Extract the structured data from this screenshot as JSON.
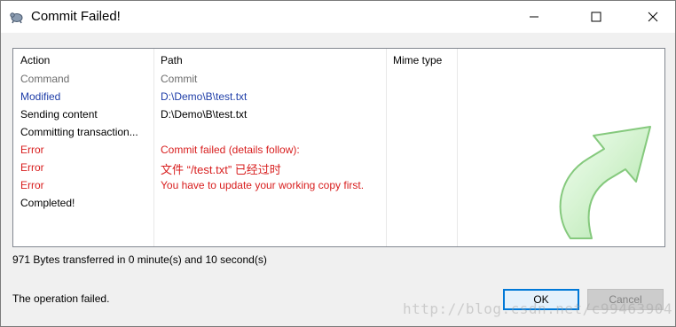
{
  "window": {
    "title": "Commit Failed!"
  },
  "list": {
    "headers": {
      "action": "Action",
      "path": "Path",
      "mime": "Mime type"
    },
    "rows": [
      {
        "action": "Command",
        "path": "Commit",
        "color": "#6d6d6d"
      },
      {
        "action": "Modified",
        "path": "D:\\Demo\\B\\test.txt",
        "color": "#1f3ea8"
      },
      {
        "action": "Sending content",
        "path": "D:\\Demo\\B\\test.txt",
        "color": "#000000"
      },
      {
        "action": "Committing transaction...",
        "path": "",
        "color": "#000000"
      },
      {
        "action": "Error",
        "path": "Commit failed (details follow):",
        "color": "#d81e1e"
      },
      {
        "action": "Error",
        "path": "文件 “/test.txt” 已经过时",
        "color": "#d81e1e"
      },
      {
        "action": "Error",
        "path": "You have to update your working copy first.",
        "color": "#d81e1e"
      },
      {
        "action": "Completed!",
        "path": "",
        "color": "#000000"
      }
    ]
  },
  "status_text": "971 Bytes transferred in 0 minute(s) and 10 second(s)",
  "result_text": "The operation failed.",
  "buttons": {
    "ok": "OK",
    "cancel": "Cancel"
  },
  "watermark": "http://blog.csdn.net/c99463904",
  "icons": {
    "app": "tortoise-svn-icon",
    "progress": "green-curved-arrow-icon",
    "minimize": "minimize-icon",
    "maximize": "maximize-icon",
    "close": "close-icon"
  }
}
